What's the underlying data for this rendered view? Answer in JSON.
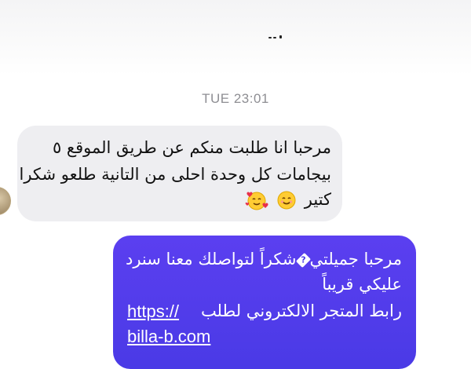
{
  "timestamp": "TUE 23:01",
  "incoming": {
    "lines": [
      "مرحبا انا طلبت منكم عن طريق الموقع ٥",
      "بيجامات كل وحدة احلى من التانية طلعو شكرا",
      "كتير"
    ],
    "emojis": [
      "smiling-face-emoji",
      "smiling-face-with-hearts-emoji"
    ]
  },
  "outgoing": {
    "line1_before": "مرحبا جميلتي",
    "line1_after": "شكراً لتواصلك معنا سنرد",
    "line2": "عليكي قريباً",
    "line3_text": "رابط المتجر الالكتروني لطلب",
    "link_part1": "https://",
    "link_part2": "billa-b.com"
  },
  "colors": {
    "incoming_bubble": "#eeeef1",
    "outgoing_bubble": "#4a3ae6",
    "timestamp": "#8e8e93"
  }
}
